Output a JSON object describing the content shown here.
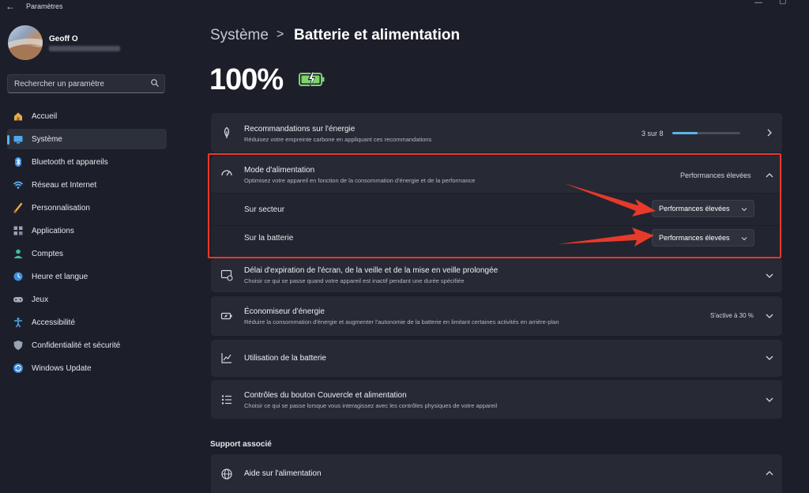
{
  "window": {
    "title": "Paramètres"
  },
  "user": {
    "name": "Geoff O"
  },
  "search": {
    "placeholder": "Rechercher un paramètre"
  },
  "sidebar": {
    "items": [
      {
        "label": "Accueil",
        "icon": "home-icon"
      },
      {
        "label": "Système",
        "icon": "system-icon",
        "active": true
      },
      {
        "label": "Bluetooth et appareils",
        "icon": "bluetooth-icon"
      },
      {
        "label": "Réseau et Internet",
        "icon": "network-icon"
      },
      {
        "label": "Personnalisation",
        "icon": "brush-icon"
      },
      {
        "label": "Applications",
        "icon": "apps-icon"
      },
      {
        "label": "Comptes",
        "icon": "account-icon"
      },
      {
        "label": "Heure et langue",
        "icon": "globe-clock-icon"
      },
      {
        "label": "Jeux",
        "icon": "gamepad-icon"
      },
      {
        "label": "Accessibilité",
        "icon": "accessibility-icon"
      },
      {
        "label": "Confidentialité et sécurité",
        "icon": "shield-icon"
      },
      {
        "label": "Windows Update",
        "icon": "update-icon"
      }
    ]
  },
  "breadcrumb": {
    "parent": "Système",
    "separator": ">",
    "current": "Batterie et alimentation"
  },
  "battery": {
    "percent": "100%"
  },
  "cards": {
    "energy": {
      "title": "Recommandations sur l'énergie",
      "subtitle": "Réduisez votre empreinte carbone en appliquant ces recommandations",
      "progress_text": "3 sur 8",
      "progress_fraction": 0.375
    },
    "power_mode": {
      "title": "Mode d'alimentation",
      "subtitle": "Optimisez votre appareil en fonction de la consommation d'énergie et de la performance",
      "value": "Performances élevées",
      "rows": [
        {
          "label": "Sur secteur",
          "value": "Performances élevées"
        },
        {
          "label": "Sur la batterie",
          "value": "Performances élevées"
        }
      ]
    },
    "screen_timeout": {
      "title": "Délai d'expiration de l'écran, de la veille et de la mise en veille prolongée",
      "subtitle": "Choisir ce qui se passe quand votre appareil est inactif pendant une durée spécifiée"
    },
    "energy_saver": {
      "title": "Économiseur d'énergie",
      "subtitle": "Réduire la consommation d'énergie et augmenter l'autonomie de la batterie en limitant certaines activités en arrière-plan",
      "value": "S'active à 30 %"
    },
    "battery_usage": {
      "title": "Utilisation de la batterie"
    },
    "lid_controls": {
      "title": "Contrôles du bouton Couvercle et alimentation",
      "subtitle": "Choisir ce qui se passe lorsque vous interagissez avec les contrôles physiques de votre appareil"
    }
  },
  "support": {
    "heading": "Support associé",
    "items": [
      {
        "title": "Aide sur l'alimentation"
      }
    ]
  },
  "colors": {
    "accent": "#5fb1ea",
    "highlight": "#e8392b",
    "battery": "#7dd36a"
  }
}
